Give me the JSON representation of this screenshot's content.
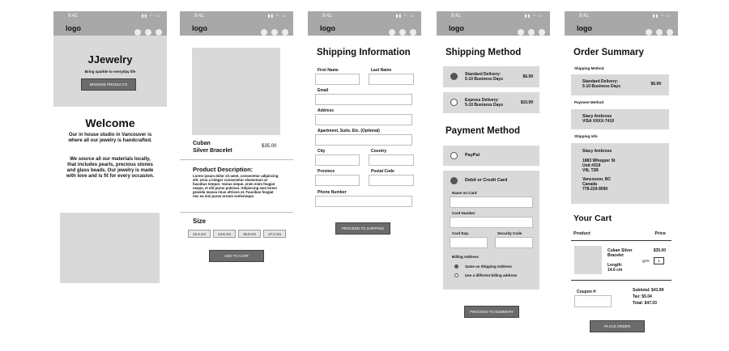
{
  "status": {
    "time": "9:41",
    "icons": "▮▮ ◠ ▭"
  },
  "logo": "logo",
  "home": {
    "brand": "JJewelry",
    "tagline": "Bring sparkle to everyday life",
    "browse_button": "BROWSE PRODUCTS",
    "welcome": "Welcome",
    "para1": "Our in house studio in Vancouver is where all our jewelry is handcrafted.",
    "para2": "We source all our materials locally, that includes pearls, precious stones and glass beads. Our jewelry is made with love and is fit for every occasion."
  },
  "product": {
    "name_line1": "Cuban",
    "name_line2": "Silver Bracelet",
    "price": "$35.00",
    "desc_title": "Product Description:",
    "desc_text": "Lorem ipsum dolor sit amet, consectetur adipiscing elit. Urna a integer consectetur elementum at faucibus tempor. Varius neque, enim enim feugiat neque, et elit purus pulvinar. Adipiscing sem lorem gravida massa risus ultrices ut. Faucibus feugiat nec eu nisi purus ornare scelerisque.",
    "size_title": "Size",
    "sizes": [
      "13.4 cm",
      "14.6 cm",
      "15.9 cm",
      "17.2 cm"
    ],
    "add_to_cart": "ADD TO CART"
  },
  "shipping": {
    "title": "Shipping Information",
    "first_name": "First Name",
    "last_name": "Last Name",
    "email": "Email",
    "address": "Address",
    "apartment": "Apartment, Suite, Etc. (Optional)",
    "city": "City",
    "country": "Country",
    "province": "Province",
    "postal": "Postal Code",
    "phone": "Phone Number",
    "proceed": "PROCEED TO SHIPPING"
  },
  "method": {
    "title": "Shipping Method",
    "standard_line1": "Standard Delivery:",
    "standard_line2": "5-10 Business Days",
    "standard_price": "$6.99",
    "express_line1": "Express Delivery:",
    "express_line2": "5-10 Business Days",
    "express_price": "$10.99",
    "payment_title": "Payment Method",
    "paypal": "PayPal",
    "card": "Debit or Credit Card",
    "name_on_card": "Name on Card",
    "card_number": "Card Number",
    "card_exp": "Card Exp.",
    "security_code": "Security Code",
    "billing": "Billing Address",
    "same_as_shipping": "Same as Shipping Address",
    "different_billing": "Use a different billing address",
    "proceed": "PROCEED TO SUMMARY"
  },
  "summary": {
    "title": "Order Summary",
    "shipping_method_label": "Shipping Method",
    "standard_line1": "Standard Delivery:",
    "standard_line2": "5-10 Business Days",
    "standard_price": "$6.99",
    "payment_method_label": "Payment Method",
    "payer_name": "Stacy Ambrose",
    "card": "VISA XXXX-7410",
    "shipping_info_label": "Shipping Info",
    "ship_name": "Stacy Ambrose",
    "addr1": "1883 Whopper St",
    "addr2": "Unit #319",
    "addr3": "V9L T2R",
    "addr4": "Vancouver, BC",
    "addr5": "Canada",
    "phone": "778-229-9090",
    "cart_title": "Your Cart",
    "col_product": "Product",
    "col_price": "Price",
    "item_name_line1": "Cuban Silver",
    "item_name_line2": "Bracelet",
    "item_price": "$35.00",
    "qty_label": "QTY:",
    "qty_value": "1",
    "length_label": "Length:",
    "length_value": "14.6 cm",
    "coupon_label": "Coupon #:",
    "subtotal": "Subtotal: $41.99",
    "tax": "Tax: $5.04",
    "total": "Total: $47.03",
    "place_order": "PLACE ORDER"
  }
}
